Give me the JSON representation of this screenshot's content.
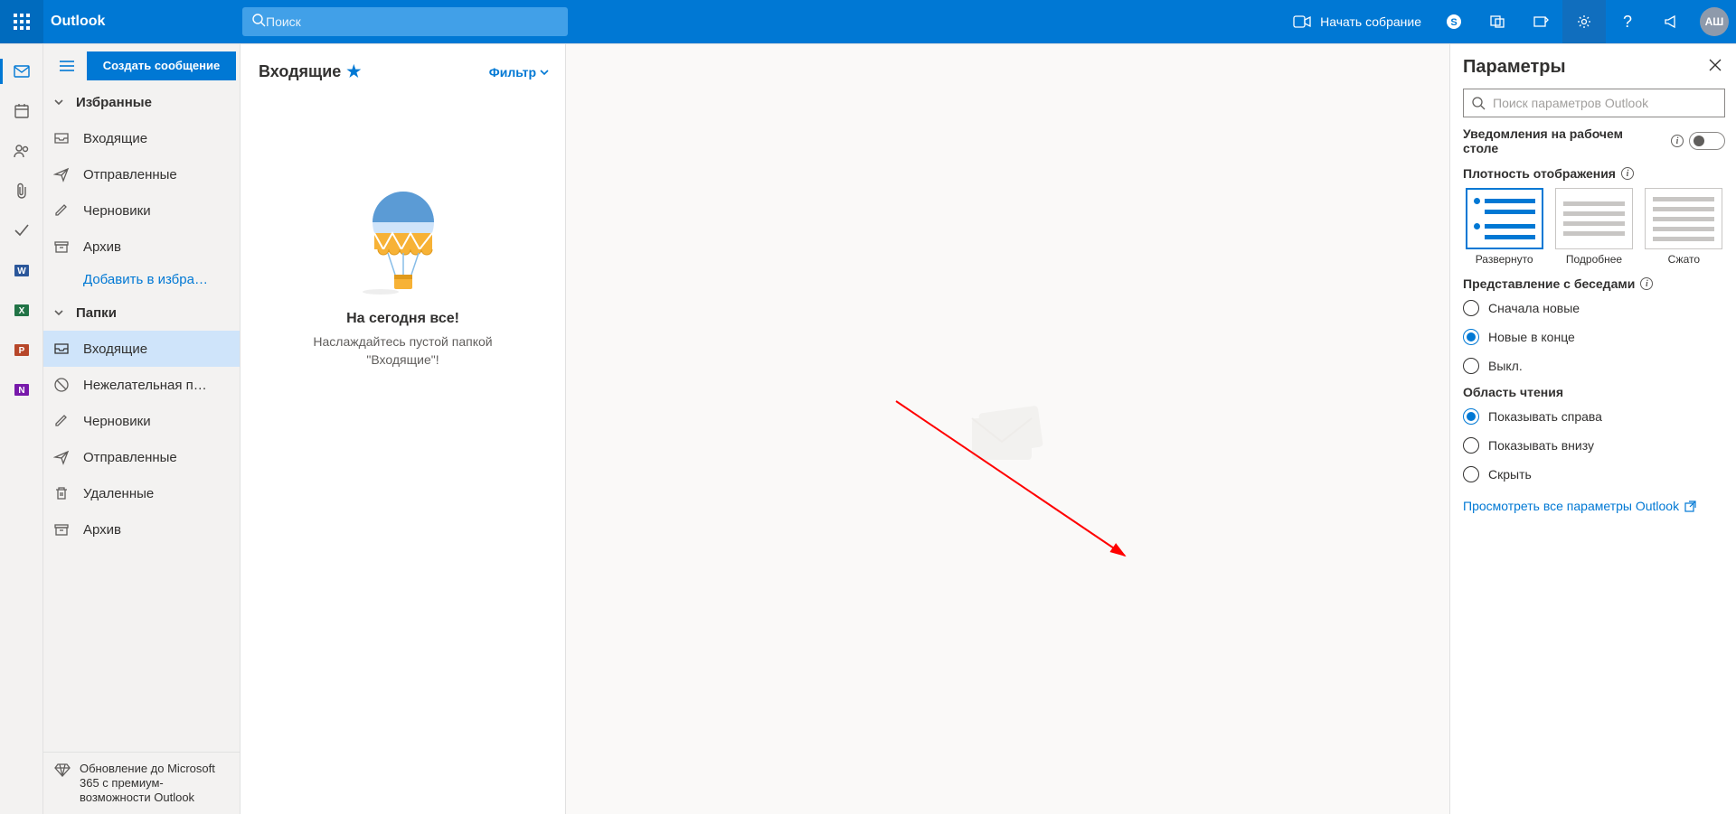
{
  "header": {
    "brand": "Outlook",
    "search_placeholder": "Поиск",
    "meet_label": "Начать собрание",
    "avatar": "АШ"
  },
  "compose_label": "Создать сообщение",
  "sections": {
    "favorites_title": "Избранные",
    "folders_title": "Папки",
    "add_favorite": "Добавить в избра…"
  },
  "favorites": [
    {
      "icon": "inbox",
      "label": "Входящие"
    },
    {
      "icon": "send",
      "label": "Отправленные"
    },
    {
      "icon": "draft",
      "label": "Черновики"
    },
    {
      "icon": "archive",
      "label": "Архив"
    }
  ],
  "folders": [
    {
      "icon": "inbox",
      "label": "Входящие",
      "selected": true
    },
    {
      "icon": "junk",
      "label": "Нежелательная п…"
    },
    {
      "icon": "draft",
      "label": "Черновики"
    },
    {
      "icon": "send",
      "label": "Отправленные"
    },
    {
      "icon": "trash",
      "label": "Удаленные"
    },
    {
      "icon": "archive",
      "label": "Архив"
    }
  ],
  "upsell": "Обновление до Microsoft 365 с премиум-возможности Outlook",
  "msglist": {
    "title": "Входящие",
    "filter": "Фильтр",
    "empty_title": "На сегодня все!",
    "empty_sub": "Наслаждайтесь пустой папкой \"Входящие\"!"
  },
  "settings": {
    "title": "Параметры",
    "search_placeholder": "Поиск параметров Outlook",
    "desktop_notifications": "Уведомления на рабочем столе",
    "density_title": "Плотность отображения",
    "density_options": [
      "Развернуто",
      "Подробнее",
      "Сжато"
    ],
    "density_selected": 0,
    "conversation_title": "Представление с беседами",
    "conversation_options": [
      "Сначала новые",
      "Новые в конце",
      "Выкл."
    ],
    "conversation_selected": 1,
    "reading_title": "Область чтения",
    "reading_options": [
      "Показывать справа",
      "Показывать внизу",
      "Скрыть"
    ],
    "reading_selected": 0,
    "view_all": "Просмотреть все параметры Outlook"
  }
}
